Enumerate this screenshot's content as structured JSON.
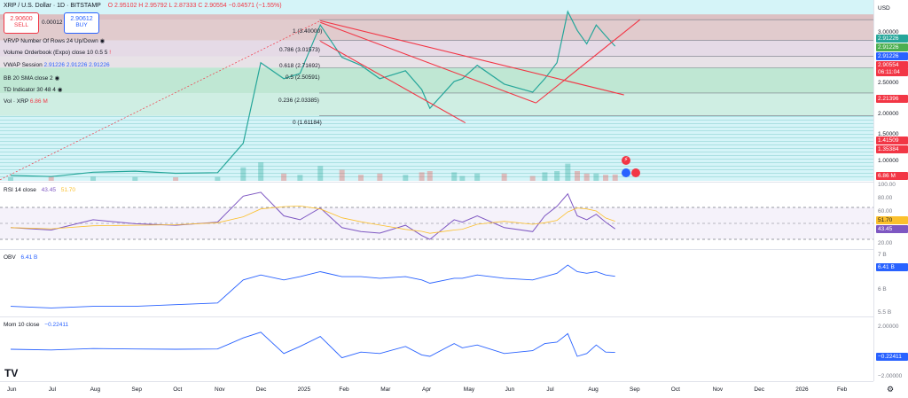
{
  "header": {
    "symbol": "XRP / U.S. Dollar · 1D · BITSTAMP",
    "ohlc": "O 2.95102  H 2.95792  L 2.87333  C 2.90554  −0.04571 (−1.55%)",
    "sell_price": "2.90600",
    "sell_label": "SELL",
    "spread": "0.00012",
    "buy_price": "2.90612",
    "buy_label": "BUY",
    "currency": "USD"
  },
  "indicators": [
    {
      "label": "VRVP Number Of Rows 24 Up/Down"
    },
    {
      "label": "Volume Orderbook (Expo) close 10 0.5 5"
    },
    {
      "label": "VWAP Session",
      "values": "2.91226  2.91226  2.91226"
    },
    {
      "label": "BB 20 SMA close 2"
    },
    {
      "label": "TD Indicator 30 48 4"
    },
    {
      "label": "Vol · XRP",
      "values": "6.86 M"
    }
  ],
  "fib_labels": [
    "1 (3.40000)",
    "0.786 (3.01573)",
    "0.618 (2.71692)",
    "0.5 (2.50591)",
    "0.236 (2.03385)",
    "0 (1.61184)"
  ],
  "price_axis": {
    "ticks": [
      "3.00000",
      "2.50000",
      "2.00000",
      "1.50000",
      "1.00000"
    ],
    "tags": [
      {
        "text": "2.91226",
        "color": "#26a69a"
      },
      {
        "text": "2.91226",
        "color": "#4caf50"
      },
      {
        "text": "2.91226",
        "color": "#2962ff"
      },
      {
        "text": "2.90554",
        "color": "#f23645"
      },
      {
        "text": "06:11:04",
        "color": "#f23645"
      },
      {
        "text": "2.21396",
        "color": "#f23645"
      },
      {
        "text": "1.41509",
        "color": "#f23645"
      },
      {
        "text": "1.35384",
        "color": "#f23645"
      },
      {
        "text": "6.86 M",
        "color": "#f23645"
      }
    ]
  },
  "rsi": {
    "label": "RSI 14 close",
    "value": "43.45",
    "signal": "51.70",
    "ticks": [
      "100.00",
      "80.00",
      "60.00",
      "40.00",
      "20.00"
    ],
    "tag_signal": "51.70",
    "tag_value": "43.45"
  },
  "obv": {
    "label": "OBV",
    "value": "6.41 B",
    "ticks": [
      "7 B",
      "6 B",
      "5.5 B"
    ],
    "tag": "6.41 B"
  },
  "mom": {
    "label": "Mom 10 close",
    "value": "−0.22411",
    "ticks": [
      "2.00000",
      "−2.00000"
    ],
    "tag": "−0.22411"
  },
  "time_axis": [
    "Jun",
    "Jul",
    "Aug",
    "Sep",
    "Oct",
    "Nov",
    "Dec",
    "2025",
    "Feb",
    "Mar",
    "Apr",
    "May",
    "Jun",
    "Jul",
    "Aug",
    "Sep",
    "Oct",
    "Nov",
    "Dec",
    "2026",
    "Feb"
  ],
  "colors": {
    "up": "#26a69a",
    "down": "#ef5350",
    "rsi": "#7e57c2",
    "obv": "#2962ff",
    "mom": "#2962ff",
    "trend": "#f23645"
  },
  "chart_data": {
    "type": "line",
    "title": "XRP / U.S. Dollar · 1D · BITSTAMP",
    "x": [
      "2024-06",
      "2024-07",
      "2024-08",
      "2024-09",
      "2024-10",
      "2024-11",
      "2024-11-20",
      "2024-12-03",
      "2024-12-20",
      "2025-01",
      "2025-01-16",
      "2025-02",
      "2025-02-15",
      "2025-03",
      "2025-03-20",
      "2025-04",
      "2025-04-07",
      "2025-04-25",
      "2025-05",
      "2025-05-12",
      "2025-06",
      "2025-06-22",
      "2025-07",
      "2025-07-10",
      "2025-07-18",
      "2025-07-25",
      "2025-08",
      "2025-08-08",
      "2025-08-15",
      "2025-08-22"
    ],
    "series": [
      {
        "values": [
          0.5,
          0.48,
          0.56,
          0.58,
          0.54,
          0.55,
          1.1,
          2.6,
          2.3,
          2.4,
          3.3,
          2.7,
          2.55,
          2.3,
          2.45,
          2.1,
          1.75,
          2.25,
          2.3,
          2.55,
          2.2,
          2.05,
          2.3,
          2.6,
          3.55,
          3.2,
          2.95,
          3.3,
          3.1,
          2.90554
        ]
      }
    ],
    "ylim": [
      0.4,
      3.7
    ],
    "fib_levels": [
      3.4,
      3.01573,
      2.71692,
      2.50591,
      2.03385,
      1.61184
    ],
    "rsi": [
      45,
      42,
      55,
      50,
      48,
      52,
      85,
      90,
      60,
      55,
      70,
      45,
      40,
      38,
      48,
      35,
      30,
      55,
      52,
      60,
      45,
      40,
      60,
      72,
      88,
      60,
      55,
      62,
      52,
      43.45
    ],
    "obv": [
      5.5,
      5.45,
      5.5,
      5.5,
      5.55,
      5.6,
      6.3,
      6.45,
      6.3,
      6.4,
      6.55,
      6.4,
      6.4,
      6.35,
      6.4,
      6.3,
      6.2,
      6.35,
      6.35,
      6.45,
      6.35,
      6.3,
      6.4,
      6.5,
      6.75,
      6.55,
      6.5,
      6.55,
      6.45,
      6.41
    ],
    "mom": [
      0.0,
      -0.05,
      0.05,
      0.02,
      0.0,
      0.02,
      0.8,
      1.2,
      -0.3,
      0.2,
      0.9,
      -0.6,
      -0.2,
      -0.3,
      0.2,
      -0.4,
      -0.5,
      0.4,
      0.1,
      0.3,
      -0.3,
      -0.1,
      0.4,
      0.5,
      1.1,
      -0.5,
      -0.3,
      0.3,
      -0.2,
      -0.22411
    ]
  }
}
